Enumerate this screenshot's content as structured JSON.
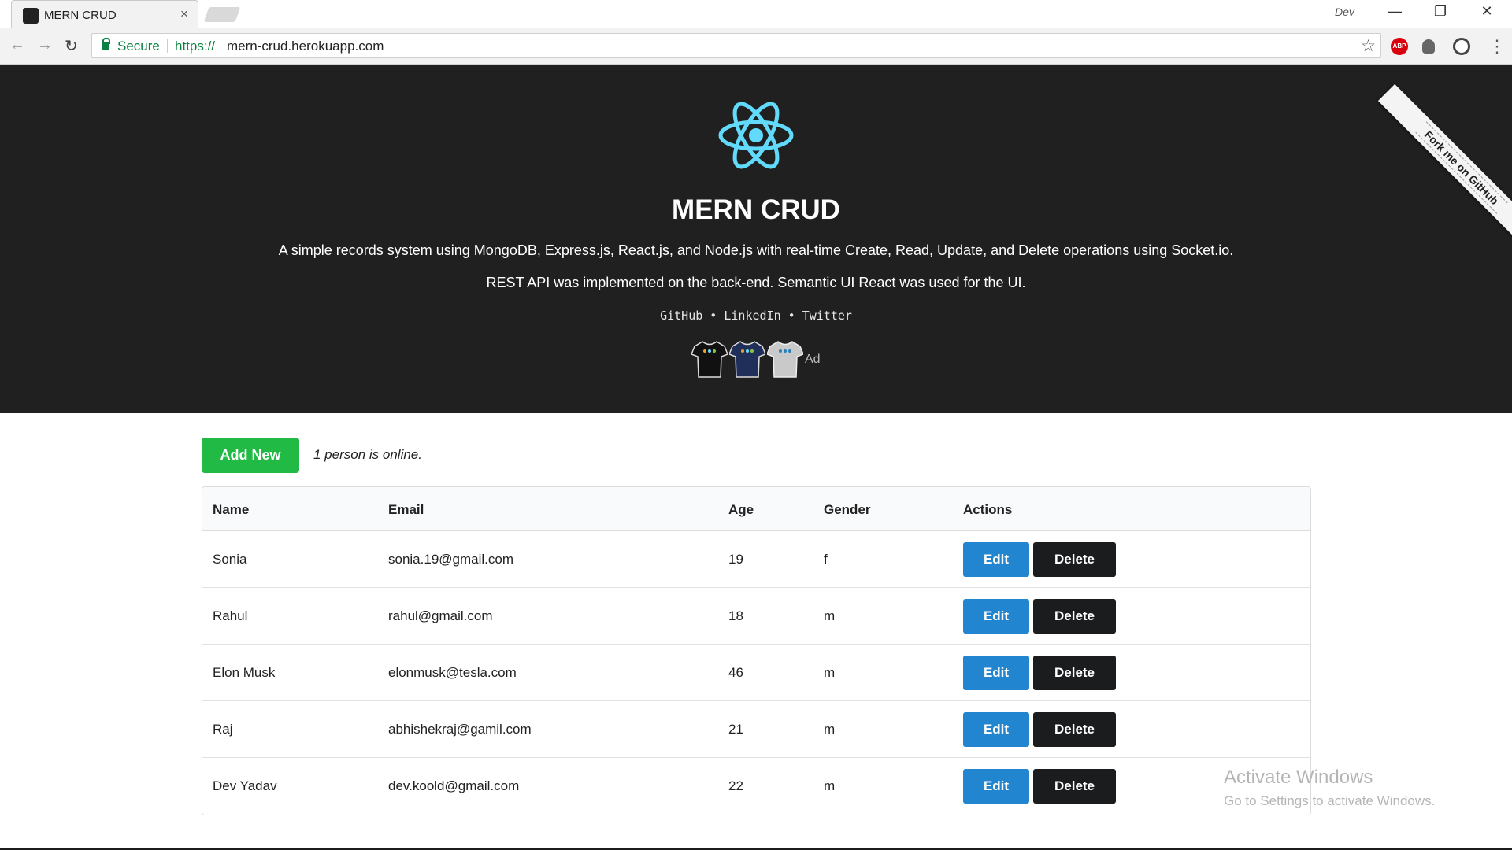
{
  "browser": {
    "tab_title": "MERN CRUD",
    "tab_close": "×",
    "profile": "Dev",
    "window_controls": {
      "minimize": "—",
      "restore": "❐",
      "close": "✕"
    },
    "nav": {
      "back": "←",
      "forward": "→",
      "reload": "↻"
    },
    "secure_label": "Secure",
    "url_scheme": "https://",
    "url_host": "mern-crud.herokuapp.com",
    "bookmark_icon": "☆",
    "abp_label": "ABP",
    "menu_icon": "⋮"
  },
  "hero": {
    "title": "MERN CRUD",
    "description_1": "A simple records system using MongoDB, Express.js, React.js, and Node.js with real-time Create, Read, Update, and Delete operations using Socket.io.",
    "description_2": "REST API was implemented on the back-end. Semantic UI React was used for the UI.",
    "links": [
      "GitHub",
      "LinkedIn",
      "Twitter"
    ],
    "link_separator": " • ",
    "ad_label": "Ad",
    "ribbon": "Fork me on GitHub"
  },
  "main": {
    "add_button": "Add New",
    "online_status": "1 person is online.",
    "table": {
      "headers": [
        "Name",
        "Email",
        "Age",
        "Gender",
        "Actions"
      ],
      "rows": [
        {
          "name": "Sonia",
          "email": "sonia.19@gmail.com",
          "age": "19",
          "gender": "f"
        },
        {
          "name": "Rahul",
          "email": "rahul@gmail.com",
          "age": "18",
          "gender": "m"
        },
        {
          "name": "Elon Musk",
          "email": "elonmusk@tesla.com",
          "age": "46",
          "gender": "m"
        },
        {
          "name": "Raj",
          "email": "abhishekraj@gamil.com",
          "age": "21",
          "gender": "m"
        },
        {
          "name": "Dev Yadav",
          "email": "dev.koold@gmail.com",
          "age": "22",
          "gender": "m"
        }
      ],
      "edit_label": "Edit",
      "delete_label": "Delete"
    }
  },
  "watermark": {
    "title": "Activate Windows",
    "subtitle": "Go to Settings to activate Windows."
  },
  "colors": {
    "hero_bg": "#202020",
    "react_blue": "#61dafb",
    "add_green": "#21ba45",
    "edit_blue": "#2185d0",
    "delete_black": "#1b1c1d"
  }
}
